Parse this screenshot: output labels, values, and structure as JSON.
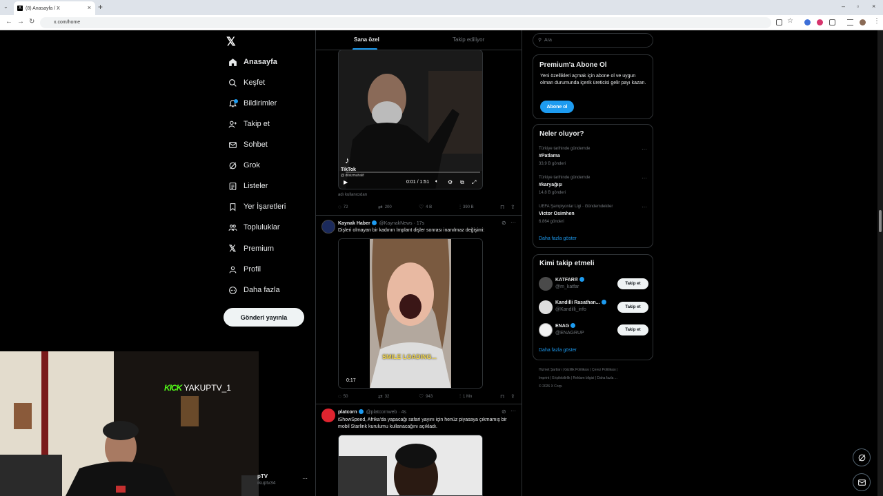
{
  "browser": {
    "tab_title": "(8) Anasayfa / X",
    "url": "x.com/home"
  },
  "sidebar": {
    "items": [
      {
        "label": "Anasayfa",
        "icon": "home-icon"
      },
      {
        "label": "Keşfet",
        "icon": "search-icon"
      },
      {
        "label": "Bildirimler",
        "icon": "bell-icon"
      },
      {
        "label": "Takip et",
        "icon": "add-person-icon"
      },
      {
        "label": "Sohbet",
        "icon": "mail-icon"
      },
      {
        "label": "Grok",
        "icon": "grok-icon"
      },
      {
        "label": "Listeler",
        "icon": "list-icon"
      },
      {
        "label": "Yer İşaretleri",
        "icon": "bookmark-icon"
      },
      {
        "label": "Topluluklar",
        "icon": "communities-icon"
      },
      {
        "label": "Premium",
        "icon": "x-icon"
      },
      {
        "label": "Profil",
        "icon": "person-icon"
      },
      {
        "label": "Daha fazla",
        "icon": "more-circle-icon"
      }
    ],
    "post_button": "Gönderi yayınla"
  },
  "feed": {
    "tabs": [
      "Sana özel",
      "Takip ediliyor"
    ],
    "post1": {
      "video_time": "0:01 / 1:51",
      "tiktok_label": "TikTok",
      "tiktok_user": "@ dilsizmuhalif",
      "caption": "adı kullanıcıdan",
      "replies": "72",
      "reposts": "200",
      "likes": "4 B",
      "views": "390 B"
    },
    "post2": {
      "name": "Kaynak Haber",
      "handle": "@KaynakNews",
      "time": "· 17s",
      "text": "Dişleri olmayan bir kadının İmplant dişler sonrası inanılmaz değişimi:",
      "video_overlay": "SMILE LOADING...",
      "duration": "0:17",
      "replies": "50",
      "reposts": "32",
      "likes": "943",
      "views": "1 Mn"
    },
    "post3": {
      "name": "platcorn",
      "handle": "@platcornweb",
      "time": "· 4s",
      "text": "iShowSpeed, Afrika'da yapacağı safari yayını için henüz piyasaya çıkmamış bir mobil Starlink kurulumu kullanacağını açıkladı."
    }
  },
  "right": {
    "search_placeholder": "Ara",
    "premium": {
      "title": "Premium'a Abone Ol",
      "text": "Yeni özellikleri açmak için abone ol ve uygun olman durumunda içerik üreticisi gelir payı kazan.",
      "button": "Abone ol"
    },
    "trends": {
      "title": "Neler oluyor?",
      "items": [
        {
          "context": "Türkiye tarihinde gündemde",
          "title": "#Patlama",
          "count": "33,9 B gönderi"
        },
        {
          "context": "Türkiye tarihinde gündemde",
          "title": "#karyağışı",
          "count": "14,8 B gönderi"
        },
        {
          "context": "UEFA Şampiyonlar Ligi · Gündemdekiler",
          "title": "Victor Osimhen",
          "count": "6.864 gönderi"
        }
      ],
      "show_more": "Daha fazla göster"
    },
    "who_to_follow": {
      "title": "Kimi takip etmeli",
      "items": [
        {
          "name": "KATFAR®",
          "handle": "@m_katfar",
          "button": "Takip et"
        },
        {
          "name": "Kandilli Rasathan...",
          "handle": "@Kandilli_info",
          "button": "Takip et"
        },
        {
          "name": "ENAG",
          "handle": "@ENAGRUP",
          "button": "Takip et"
        }
      ],
      "show_more": "Daha fazla göster"
    },
    "footer": {
      "line1": "Hizmet Şartları  |  Gizlilik Politikası  |  Çerez Politikası  |",
      "line2": "Imprint  |  Erişilebilirlik  |  Reklam bilgisi  |  Daha fazla ...",
      "line3": "© 2026 X Corp."
    }
  },
  "overlay": {
    "kick_brand": "KICK",
    "kick_user": "YAKUPTV_1",
    "account_name": "pTV",
    "account_handle": "ıkuptv34"
  },
  "colors": {
    "accent": "#1d9bf0",
    "kick_green": "#53fc18"
  }
}
